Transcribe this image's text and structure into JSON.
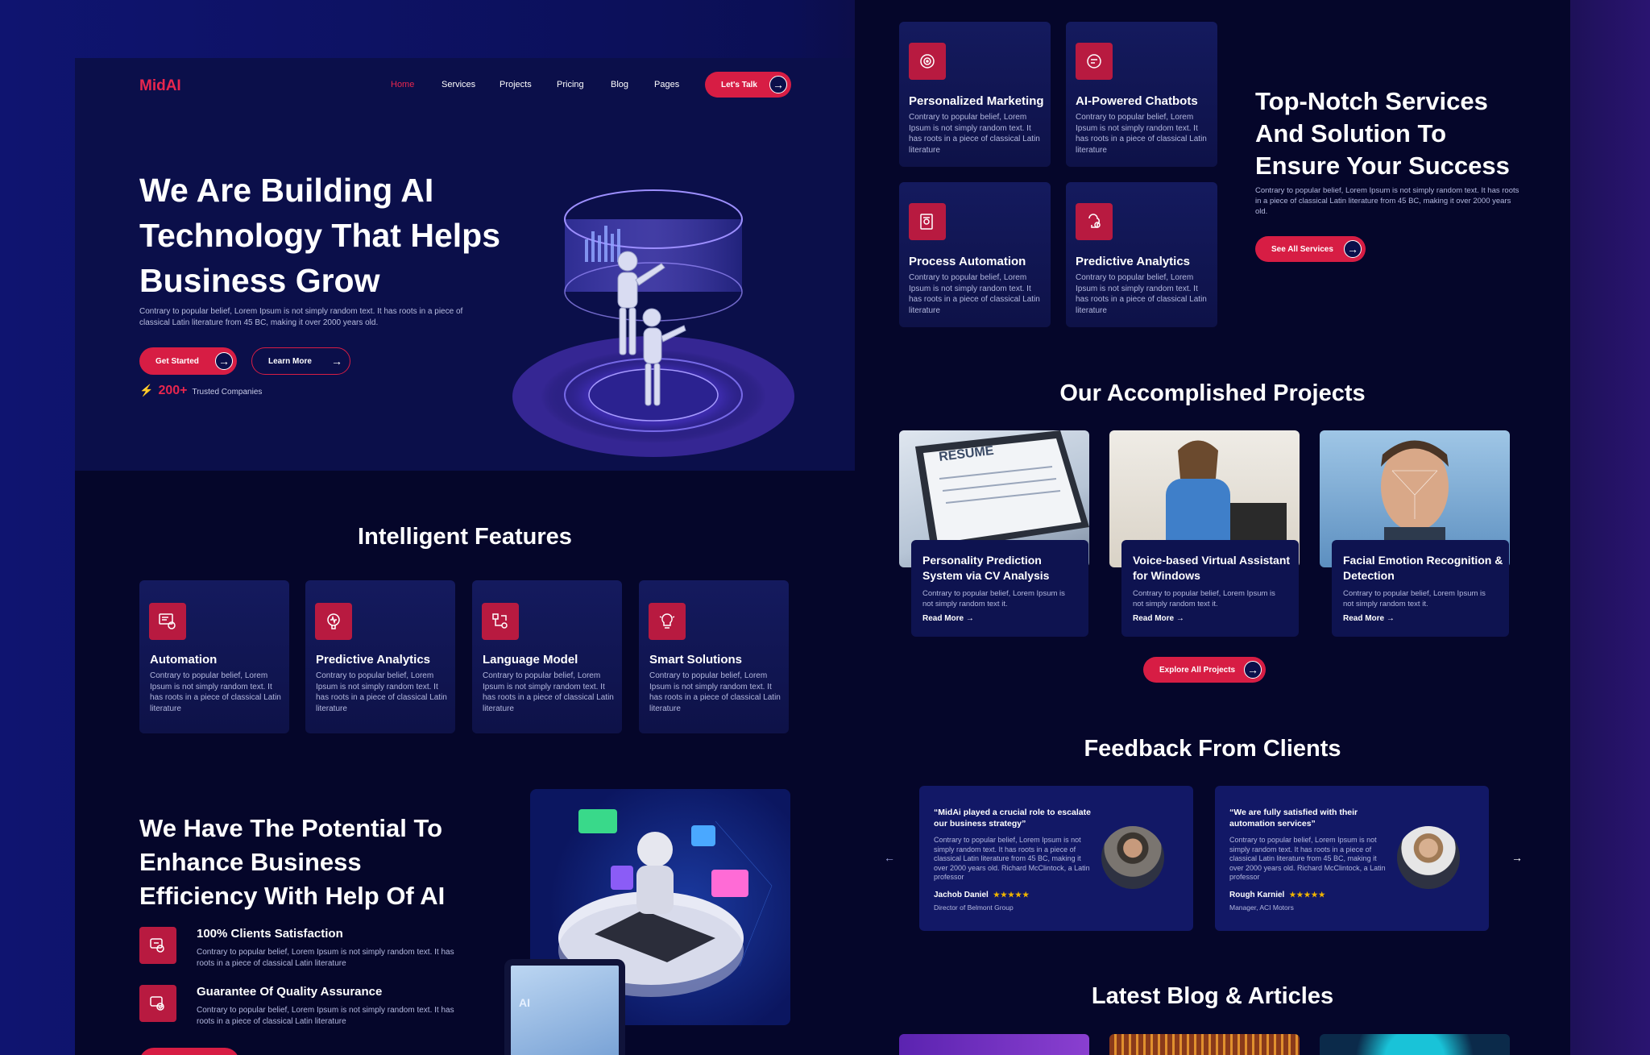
{
  "brand": {
    "logo": "MidAI"
  },
  "nav": {
    "items": [
      "Home",
      "Services",
      "Projects",
      "Pricing",
      "Blog",
      "Pages"
    ],
    "cta": "Let's Talk"
  },
  "hero": {
    "title": "We Are Building AI Technology That Helps Business Grow",
    "description": "Contrary to popular belief, Lorem Ipsum is not simply random text. It has roots in a piece of classical Latin literature from 45 BC, making it over 2000 years old.",
    "primary_button": "Get Started",
    "secondary_button": "Learn More",
    "trusted_count": "200+",
    "trusted_label": "Trusted Companies"
  },
  "features": {
    "title": "Intelligent Features",
    "items": [
      {
        "title": "Automation",
        "desc": "Contrary to popular belief, Lorem Ipsum is not simply random text. It has roots in a piece of classical Latin literature",
        "icon": "gear-screen-icon"
      },
      {
        "title": "Predictive Analytics",
        "desc": "Contrary to popular belief, Lorem Ipsum is not simply random text. It has roots in a piece of classical Latin literature",
        "icon": "brain-chart-icon"
      },
      {
        "title": "Language Model",
        "desc": "Contrary to popular belief, Lorem Ipsum is not simply random text. It has roots in a piece of classical Latin literature",
        "icon": "flow-icon"
      },
      {
        "title": "Smart Solutions",
        "desc": "Contrary to popular belief, Lorem Ipsum is not simply random text. It has roots in a piece of classical Latin literature",
        "icon": "lightbulb-icon"
      }
    ]
  },
  "potential": {
    "title": "We Have The Potential To Enhance Business Efficiency With Help Of AI",
    "points": [
      {
        "title": "100% Clients Satisfaction",
        "desc": "Contrary to popular belief, Lorem Ipsum is not simply random text. It has roots in a piece of classical Latin literature"
      },
      {
        "title": "Guarantee Of Quality Assurance",
        "desc": "Contrary to popular belief, Lorem Ipsum is not simply random text. It has roots in a piece of classical Latin literature"
      }
    ],
    "badge": "AI"
  },
  "services": {
    "items": [
      {
        "title": "Personalized Marketing",
        "desc": "Contrary to popular belief, Lorem Ipsum is not simply random text. It has roots in a piece of classical Latin literature"
      },
      {
        "title": "AI-Powered Chatbots",
        "desc": "Contrary to popular belief, Lorem Ipsum is not simply random text. It has roots in a piece of classical Latin literature"
      },
      {
        "title": "Process Automation",
        "desc": "Contrary to popular belief, Lorem Ipsum is not simply random text. It has roots in a piece of classical Latin literature"
      },
      {
        "title": "Predictive Analytics",
        "desc": "Contrary to popular belief, Lorem Ipsum is not simply random text. It has roots in a piece of classical Latin literature"
      }
    ],
    "title": "Top-Notch Services And Solution To Ensure Your Success",
    "description": "Contrary to popular belief, Lorem Ipsum is not simply random text. It has roots in a piece of classical Latin literature from 45 BC, making it over 2000 years old.",
    "button": "See All Services"
  },
  "projects": {
    "title": "Our Accomplished Projects",
    "items": [
      {
        "title": "Personality Prediction System via CV Analysis",
        "desc": "Contrary to popular belief, Lorem Ipsum is not simply random text it.",
        "link": "Read More"
      },
      {
        "title": "Voice-based Virtual Assistant for Windows",
        "desc": "Contrary to popular belief, Lorem Ipsum is not simply random text it.",
        "link": "Read More"
      },
      {
        "title": "Facial Emotion Recognition & Detection",
        "desc": "Contrary to popular belief, Lorem Ipsum is not simply random text it.",
        "link": "Read More"
      }
    ],
    "resume_label": "RESUME",
    "button": "Explore All Projects"
  },
  "feedback": {
    "title": "Feedback From Clients",
    "items": [
      {
        "quote": "“MidAi played a crucial role to escalate our business strategy”",
        "desc": "Contrary to popular belief, Lorem Ipsum is not simply random text. It has roots in a piece of classical Latin literature from 45 BC, making it over 2000 years old. Richard McClintock, a Latin professor",
        "name": "Jachob Daniel",
        "stars": "★★★★★",
        "role": "Director of Belmont Group"
      },
      {
        "quote": "“We are fully satisfied with their automation services”",
        "desc": "Contrary to popular belief, Lorem Ipsum is not simply random text. It has roots in a piece of classical Latin literature from 45 BC, making it over 2000 years old. Richard McClintock, a Latin professor",
        "name": "Rough Karniel",
        "stars": "★★★★★",
        "role": "Manager, ACI Motors"
      }
    ]
  },
  "blog": {
    "title": "Latest Blog & Articles"
  },
  "colors": {
    "accent": "#d71d44",
    "hero_bg": "#0b0f4a",
    "panel_bg": "#05062a",
    "card_bg": "#141a5e"
  }
}
